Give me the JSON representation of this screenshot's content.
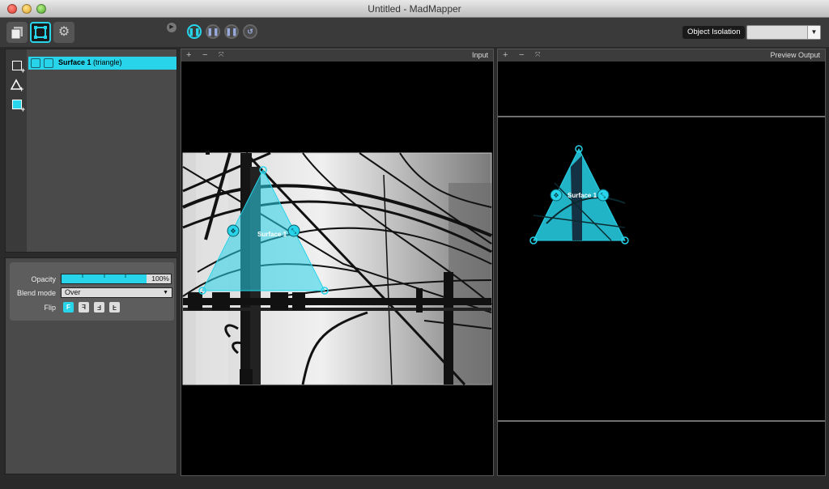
{
  "window": {
    "title": "Untitled - MadMapper"
  },
  "toolbar": {
    "tabs": [
      {
        "icon": "media-icon"
      },
      {
        "icon": "surfaces-icon"
      },
      {
        "icon": "settings-icon"
      }
    ],
    "object_isolation_label": "Object Isolation",
    "isolation_select_value": ""
  },
  "sidebar": {
    "tools": [
      {
        "icon": "add-quad-icon"
      },
      {
        "icon": "add-triangle-icon"
      },
      {
        "icon": "add-mask-icon"
      }
    ],
    "surfaces": [
      {
        "name": "Surface 1",
        "type": "(triangle)",
        "selected": true
      }
    ]
  },
  "properties": {
    "opacity_label": "Opacity",
    "opacity_value": "100%",
    "opacity_fraction": 1.0,
    "blend_label": "Blend mode",
    "blend_value": "Over",
    "flip_label": "Flip",
    "flip_buttons": [
      "F",
      "F",
      "F",
      "F"
    ]
  },
  "input_view": {
    "title": "Input",
    "surface_label": "Surface 1"
  },
  "output_view": {
    "title": "Preview Output",
    "surface_label": "Surface 1"
  },
  "colors": {
    "accent": "#27d4ea",
    "panel": "#4a4a4a",
    "background": "#2a2a2a"
  }
}
